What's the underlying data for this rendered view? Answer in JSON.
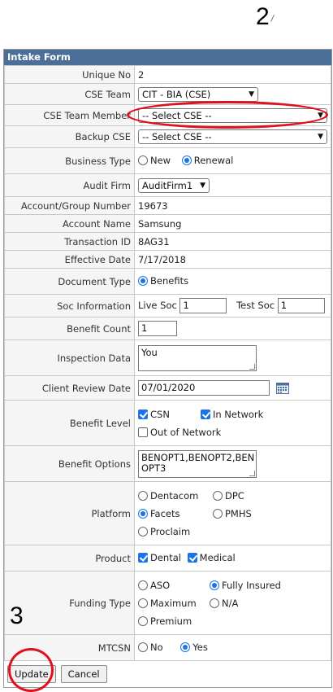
{
  "annotations": {
    "top_number": "2",
    "bottom_number": "3"
  },
  "form": {
    "title": "Intake Form",
    "unique_no": {
      "label": "Unique No",
      "value": "2"
    },
    "cse_team": {
      "label": "CSE Team",
      "value": "CIT - BIA (CSE)"
    },
    "cse_team_member": {
      "label": "CSE Team Member",
      "value": "-- Select CSE --"
    },
    "backup_cse": {
      "label": "Backup CSE",
      "value": "-- Select CSE --"
    },
    "business_type": {
      "label": "Business Type",
      "options": [
        "New",
        "Renewal"
      ],
      "selected": "Renewal"
    },
    "audit_firm": {
      "label": "Audit Firm",
      "value": "AuditFirm1"
    },
    "account_group_number": {
      "label": "Account/Group Number",
      "value": "19673"
    },
    "account_name": {
      "label": "Account Name",
      "value": "Samsung"
    },
    "transaction_id": {
      "label": "Transaction ID",
      "value": "8AG31"
    },
    "effective_date": {
      "label": "Effective Date",
      "value": "7/17/2018"
    },
    "document_type": {
      "label": "Document Type",
      "option": "Benefits"
    },
    "soc_information": {
      "label": "Soc Information",
      "live_label": "Live Soc",
      "live_value": "1",
      "test_label": "Test Soc",
      "test_value": "1"
    },
    "benefit_count": {
      "label": "Benefit Count",
      "value": "1"
    },
    "inspection_data": {
      "label": "Inspection Data",
      "value": "You"
    },
    "client_review_date": {
      "label": "Client Review Date",
      "value": "07/01/2020"
    },
    "benefit_level": {
      "label": "Benefit Level",
      "csn": "CSN",
      "in_network": "In Network",
      "out_of_network": "Out of Network"
    },
    "benefit_options": {
      "label": "Benefit Options",
      "line1": "BENOPT1,BENOPT2,BEN",
      "line2": "OPT3"
    },
    "platform": {
      "label": "Platform",
      "dentacom": "Dentacom",
      "dpc": "DPC",
      "facets": "Facets",
      "pmhs": "PMHS",
      "proclaim": "Proclaim",
      "selected": "Facets"
    },
    "product": {
      "label": "Product",
      "dental": "Dental",
      "medical": "Medical"
    },
    "funding_type": {
      "label": "Funding Type",
      "aso": "ASO",
      "fully_insured": "Fully Insured",
      "maximum": "Maximum",
      "na": "N/A",
      "premium": "Premium",
      "selected": "Fully Insured"
    },
    "mtcsn": {
      "label": "MTCSN",
      "no": "No",
      "yes": "Yes",
      "selected": "Yes"
    },
    "buttons": {
      "update": "Update",
      "cancel": "Cancel"
    }
  },
  "colors": {
    "header_bg": "#4c6f99",
    "accent": "#1a73e8",
    "highlight_circle": "#e0101c"
  }
}
